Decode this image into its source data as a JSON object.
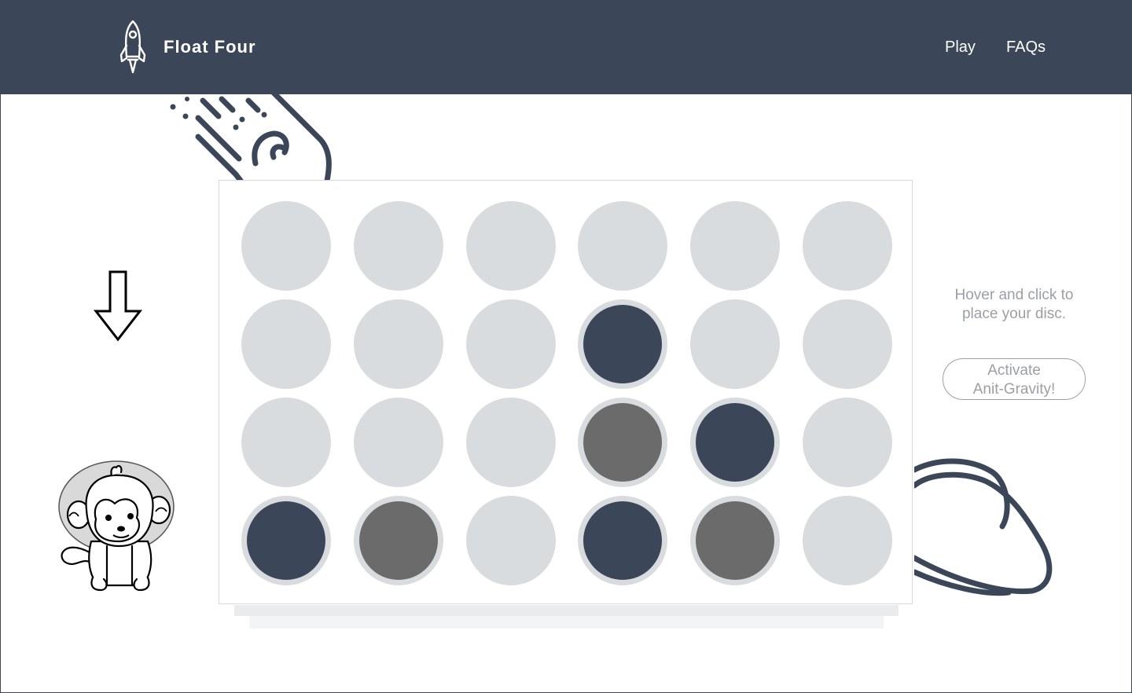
{
  "header": {
    "brand": "Float Four",
    "logo_icon": "rocket-icon",
    "nav": [
      {
        "label": "Play"
      },
      {
        "label": "FAQs"
      }
    ],
    "background": "#3b4759"
  },
  "board": {
    "rows": 4,
    "cols": 6,
    "cells": [
      [
        "empty",
        "empty",
        "empty",
        "empty",
        "empty",
        "empty"
      ],
      [
        "empty",
        "empty",
        "empty",
        "navy",
        "empty",
        "empty"
      ],
      [
        "empty",
        "empty",
        "empty",
        "gray",
        "navy",
        "empty"
      ],
      [
        "navy",
        "gray",
        "empty",
        "navy",
        "gray",
        "empty"
      ]
    ],
    "colors": {
      "empty": "#d9dcdf",
      "navy": "#3b4759",
      "gray": "#6b6b6b"
    }
  },
  "hint": "Hover and click to place your disc.",
  "anti_gravity_button": {
    "line1": "Activate",
    "line2": "Anit-Gravity!"
  },
  "decorations": {
    "comet": "comet-icon",
    "planet": "planet-icon",
    "arrow": "down-arrow-icon",
    "monkey": "astronaut-monkey-icon"
  }
}
